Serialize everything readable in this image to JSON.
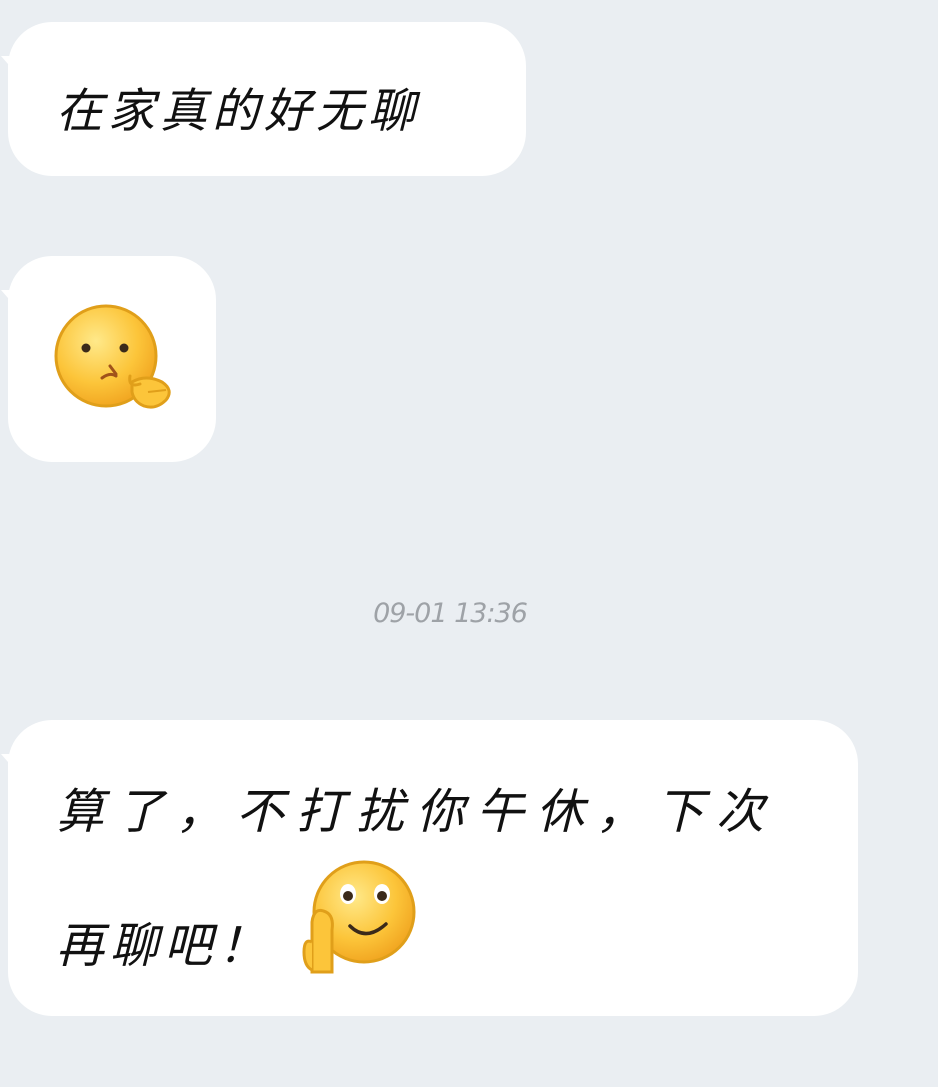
{
  "messages": [
    {
      "text": "在家真的好无聊"
    },
    {
      "emoji": "thinking-face-icon"
    },
    {
      "lines": [
        "算了，不打扰你午休，下次",
        "再聊吧！"
      ],
      "emoji": "shy-smile-face-icon"
    }
  ],
  "timestamp": "09-01 13:36",
  "colors": {
    "background": "#eaeef2",
    "bubble": "#ffffff",
    "text": "#111111",
    "timestamp": "#9ea2a7",
    "emoji_fill": "#fcc53a",
    "emoji_outline": "#e09f1a"
  }
}
